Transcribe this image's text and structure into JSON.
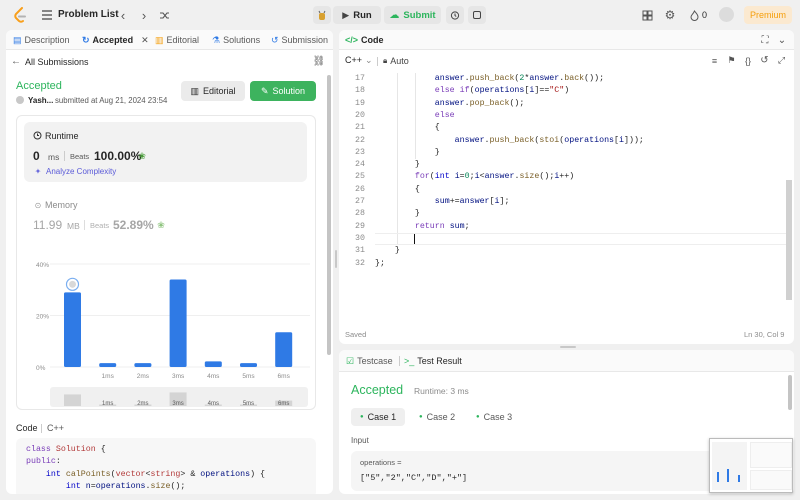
{
  "topbar": {
    "problem_list": "Problem List",
    "run": "Run",
    "submit": "Submit",
    "streak": "0",
    "premium": "Premium"
  },
  "left_tabs": [
    "Description",
    "Accepted",
    "Editorial",
    "Solutions",
    "Submission"
  ],
  "submission": {
    "back_label": "All Submissions",
    "status": "Accepted",
    "user": "Yash...",
    "submitted": "submitted at Aug 21, 2024 23:54",
    "editorial_btn": "Editorial",
    "solution_btn": "Solution",
    "runtime_label": "Runtime",
    "runtime_value": "0",
    "runtime_unit": "ms",
    "beats_label": "Beats",
    "runtime_beats": "100.00%",
    "analyze": "Analyze Complexity",
    "memory_label": "Memory",
    "memory_value": "11.99",
    "memory_unit": "MB",
    "memory_beats": "52.89%",
    "code_label": "Code",
    "code_lang": "C++"
  },
  "chart_data": {
    "type": "bar",
    "categories": [
      "",
      "1ms",
      "2ms",
      "3ms",
      "4ms",
      "5ms",
      "6ms"
    ],
    "values": [
      29,
      1.5,
      1.5,
      34,
      2.2,
      1.5,
      13.5
    ],
    "y_ticks": [
      "40%",
      "20%",
      "0%"
    ],
    "ylim": [
      0,
      40
    ],
    "highlight_index": 0,
    "bar_color": "#2f7ae5"
  },
  "left_code": [
    [
      [
        "kw",
        "class "
      ],
      [
        "cls",
        "Solution "
      ],
      [
        "plain",
        "{"
      ]
    ],
    [
      [
        "kw",
        "public"
      ],
      [
        "plain",
        ":"
      ]
    ],
    [
      [
        "plain",
        "    "
      ],
      [
        "typ",
        "int "
      ],
      [
        "fn",
        "calPoints"
      ],
      [
        "plain",
        "("
      ],
      [
        "cls",
        "vector"
      ],
      [
        "plain",
        "<"
      ],
      [
        "cls",
        "string"
      ],
      [
        "plain",
        "> & "
      ],
      [
        "var",
        "operations"
      ],
      [
        "plain",
        ") {"
      ]
    ],
    [
      [
        "plain",
        "        "
      ],
      [
        "typ",
        "int "
      ],
      [
        "var",
        "n"
      ],
      [
        "plain",
        "="
      ],
      [
        "var",
        "operations"
      ],
      [
        "plain",
        "."
      ],
      [
        "fn",
        "size"
      ],
      [
        "plain",
        "();"
      ]
    ]
  ],
  "editor": {
    "title": "Code",
    "language": "C++",
    "mode": "Auto",
    "saved": "Saved",
    "position": "Ln 30, Col 9",
    "first_line_no": 17,
    "lines": [
      [
        [
          "plain",
          "            "
        ],
        [
          "var",
          "answer"
        ],
        [
          "plain",
          "."
        ],
        [
          "fn",
          "push_back"
        ],
        [
          "plain",
          "("
        ],
        [
          "num",
          "2"
        ],
        [
          "plain",
          "*"
        ],
        [
          "var",
          "answer"
        ],
        [
          "plain",
          "."
        ],
        [
          "fn",
          "back"
        ],
        [
          "plain",
          "());"
        ]
      ],
      [
        [
          "plain",
          "            "
        ],
        [
          "kw",
          "else if"
        ],
        [
          "plain",
          "("
        ],
        [
          "var",
          "operations"
        ],
        [
          "plain",
          "["
        ],
        [
          "var",
          "i"
        ],
        [
          "plain",
          "]=="
        ],
        [
          "str",
          "\"C\""
        ],
        [
          "plain",
          ")"
        ]
      ],
      [
        [
          "plain",
          "            "
        ],
        [
          "var",
          "answer"
        ],
        [
          "plain",
          "."
        ],
        [
          "fn",
          "pop_back"
        ],
        [
          "plain",
          "();"
        ]
      ],
      [
        [
          "plain",
          "            "
        ],
        [
          "kw",
          "else"
        ]
      ],
      [
        [
          "plain",
          "            {"
        ]
      ],
      [
        [
          "plain",
          "                "
        ],
        [
          "var",
          "answer"
        ],
        [
          "plain",
          "."
        ],
        [
          "fn",
          "push_back"
        ],
        [
          "plain",
          "("
        ],
        [
          "fn",
          "stoi"
        ],
        [
          "plain",
          "("
        ],
        [
          "var",
          "operations"
        ],
        [
          "plain",
          "["
        ],
        [
          "var",
          "i"
        ],
        [
          "plain",
          "]));"
        ]
      ],
      [
        [
          "plain",
          "            }"
        ]
      ],
      [
        [
          "plain",
          "        }"
        ]
      ],
      [
        [
          "plain",
          "        "
        ],
        [
          "kw",
          "for"
        ],
        [
          "plain",
          "("
        ],
        [
          "typ",
          "int "
        ],
        [
          "var",
          "i"
        ],
        [
          "plain",
          "="
        ],
        [
          "num",
          "0"
        ],
        [
          "plain",
          ";"
        ],
        [
          "var",
          "i"
        ],
        [
          "plain",
          "<"
        ],
        [
          "var",
          "answer"
        ],
        [
          "plain",
          "."
        ],
        [
          "fn",
          "size"
        ],
        [
          "plain",
          "();"
        ],
        [
          "var",
          "i"
        ],
        [
          "plain",
          "++)"
        ]
      ],
      [
        [
          "plain",
          "        {"
        ]
      ],
      [
        [
          "plain",
          "            "
        ],
        [
          "var",
          "sum"
        ],
        [
          "plain",
          "+="
        ],
        [
          "var",
          "answer"
        ],
        [
          "plain",
          "["
        ],
        [
          "var",
          "i"
        ],
        [
          "plain",
          "];"
        ]
      ],
      [
        [
          "plain",
          "        }"
        ]
      ],
      [
        [
          "plain",
          "        "
        ],
        [
          "kw",
          "return "
        ],
        [
          "var",
          "sum"
        ],
        [
          "plain",
          ";"
        ]
      ],
      [
        [
          "plain",
          "        "
        ]
      ],
      [
        [
          "plain",
          "    }"
        ]
      ],
      [
        [
          "plain",
          "};"
        ]
      ]
    ]
  },
  "bottom": {
    "testcase_tab": "Testcase",
    "result_tab": "Test Result",
    "status": "Accepted",
    "runtime": "Runtime: 3 ms",
    "cases": [
      "Case 1",
      "Case 2",
      "Case 3"
    ],
    "input_label": "Input",
    "param_name": "operations =",
    "param_value": "[\"5\",\"2\",\"C\",\"D\",\"+\"]"
  }
}
